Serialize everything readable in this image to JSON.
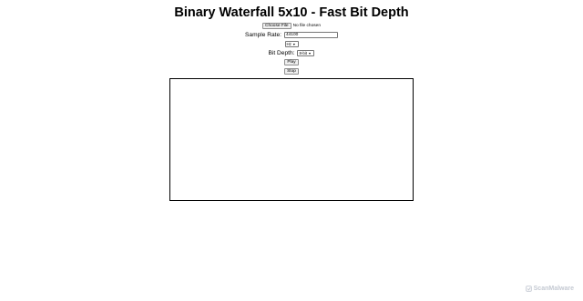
{
  "page": {
    "title": "Binary Waterfall 5x10 - Fast Bit Depth"
  },
  "file": {
    "button_label": "Choose File",
    "status": "No file chosen"
  },
  "sample_rate": {
    "label": "Sample Rate:",
    "value": "44100",
    "unit_selected": "Hz"
  },
  "bit_depth": {
    "label": "Bit Depth:",
    "selected": "8-bit"
  },
  "controls": {
    "play_label": "Play",
    "stop_label": "Stop"
  },
  "watermark": {
    "text": "ScanMalware"
  },
  "icons": {
    "select_arrow": "chevron-down-icon",
    "watermark_logo": "scanmalware-logo-icon"
  },
  "colors": {
    "canvas_border": "#000000",
    "watermark": "#c4c9d2"
  }
}
